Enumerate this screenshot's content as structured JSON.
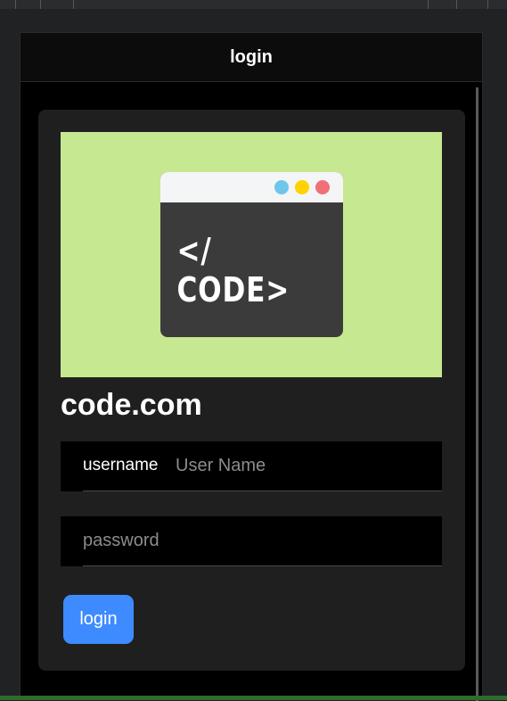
{
  "window": {
    "title": "login"
  },
  "banner": {
    "code_text": "</ CODE>",
    "background_color": "#c5e890",
    "dots": [
      {
        "color": "#6ec6ea"
      },
      {
        "color": "#ffd200"
      },
      {
        "color": "#f07078"
      }
    ]
  },
  "site_title": "code.com",
  "form": {
    "username_label": "username",
    "username_placeholder": "User Name",
    "username_value": "",
    "password_placeholder": "password",
    "password_value": "",
    "login_label": "login"
  },
  "colors": {
    "accent": "#3d8bff",
    "card": "#1f1f1f",
    "page": "#000000"
  }
}
